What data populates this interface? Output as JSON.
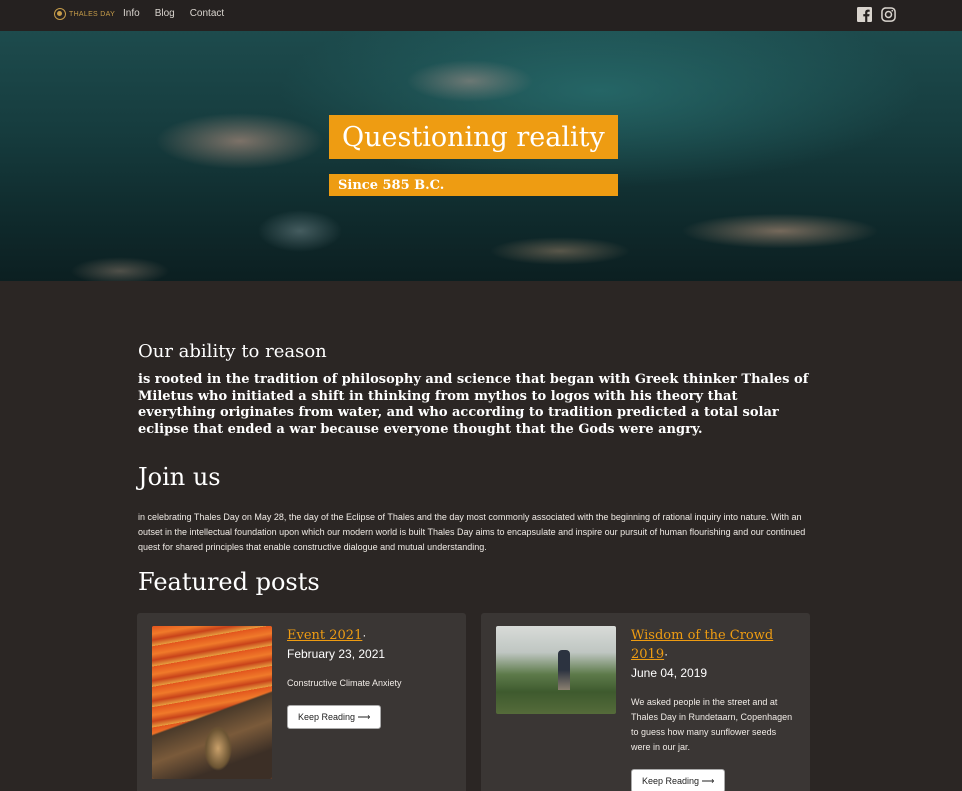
{
  "nav": {
    "logo_text": "THALES DAY",
    "links": [
      "Info",
      "Blog",
      "Contact"
    ],
    "social": [
      "facebook-icon",
      "instagram-icon"
    ]
  },
  "hero": {
    "title": "Questioning reality",
    "subtitle": "Since 585 B.C."
  },
  "reason": {
    "heading": "Our ability to reason",
    "text": "is rooted in the tradition of philosophy and science that began with Greek thinker Thales of Miletus who initiated a shift in thinking from mythos to logos with his theory that everything originates from water, and who according to tradition predicted a total solar eclipse that ended a war because everyone thought that the Gods were angry."
  },
  "join": {
    "heading": "Join us",
    "text": "in celebrating Thales Day on May 28, the day of the Eclipse of Thales and the day most commonly associated with the beginning of rational inquiry into nature. With an outset in the intellectual foundation upon which our modern world is built Thales Day aims to encapsulate and inspire our pursuit of human flourishing and our continued quest for shared principles that enable constructive dialogue and mutual understanding."
  },
  "featured": {
    "heading": "Featured posts",
    "posts": [
      {
        "title": "Event 2021",
        "date": "February 23, 2021",
        "description": "Constructive Climate Anxiety",
        "button": "Keep Reading ⟶"
      },
      {
        "title": "Wisdom of the Crowd 2019",
        "date": "June 04, 2019",
        "description": "We asked people in the street and at Thales Day in Rundetaarn, Copenhagen to guess how many sunflower seeds were in our jar.",
        "button": "Keep Reading ⟶"
      }
    ]
  },
  "colors": {
    "accent": "#ee9c12",
    "background": "#2b2624",
    "nav": "#252120",
    "card": "#3a3634"
  }
}
